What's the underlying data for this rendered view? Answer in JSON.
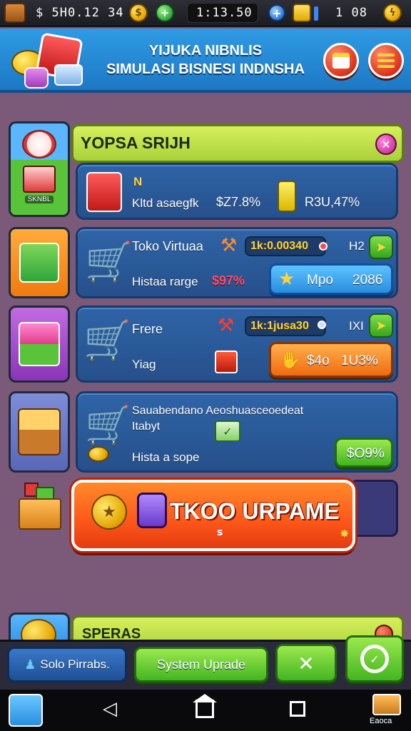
{
  "status_bar": {
    "money": "$ 5H0.12 34",
    "time": "1:13.50",
    "gems": "1 08"
  },
  "header": {
    "title_line1": "YIJUKA NIBNLIS",
    "title_line2": "SIMULASI BISNESI INDNSHA"
  },
  "main_panel": {
    "title": "YOPSA SRIJH",
    "side_label": "SKNBL",
    "summary": {
      "label": "Kltd asaegfk",
      "value_a": "$Z7.8%",
      "value_b": "R3U,47%",
      "badge": "N"
    }
  },
  "stores": [
    {
      "name": "Toko Virtuaa",
      "amount": "1k:0.00340",
      "level": "H2",
      "sub_label": "Histaa rarge",
      "percent": "$97%",
      "button_label": "Mpo",
      "button_value": "2086"
    },
    {
      "name": "Frere",
      "amount": "1k:1jusa30",
      "level": "IXI",
      "sub_label": "Yiag",
      "button_label": "$4o",
      "button_value": "1U3%"
    },
    {
      "name": "Sauabendano Aeoshuasceoedeat",
      "line2": "Itabyt",
      "sub_label": "Hista a sope",
      "button_label": "$O9%"
    }
  ],
  "big_button": {
    "label": "TKOO URPAME",
    "sub": "s"
  },
  "bottom_panel": {
    "title": "SPERAS"
  },
  "bottom_bar": {
    "left_button": "Solo Pirrabs.",
    "middle_button": "System Uprade"
  },
  "nav": {
    "right_label": "Eaoca"
  },
  "colors": {
    "background": "#7a5a78",
    "header_blue": "#2f9be4",
    "panel_lime": "#b8e04a",
    "card_blue": "#2f64a7",
    "accent_red": "#ff4a6a",
    "gold": "#ffd43b"
  },
  "icons": {
    "money": "coin-icon",
    "gem": "gem-icon",
    "add": "plus-icon",
    "menu": "list-icon",
    "calendar": "calendar-icon",
    "close": "close-icon",
    "star": "star-icon",
    "cart": "shopping-cart-icon",
    "back": "back-icon",
    "home": "home-icon",
    "recent": "recent-apps-icon"
  }
}
